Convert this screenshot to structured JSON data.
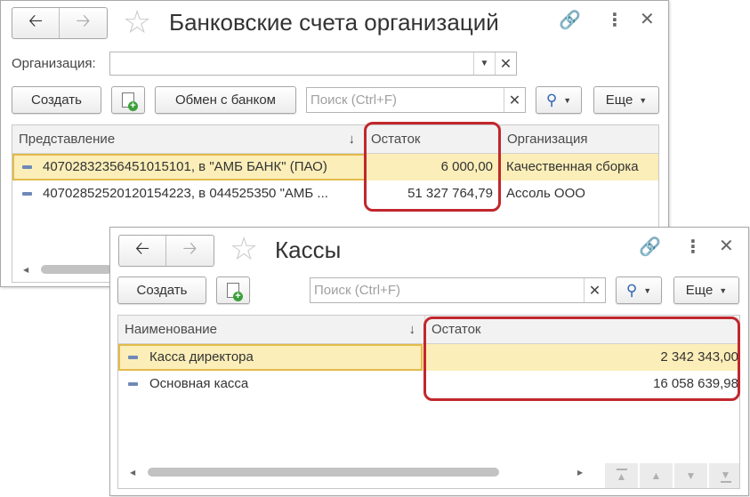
{
  "bank_window": {
    "title": "Банковские счета организаций",
    "org_label": "Организация:",
    "org_value": "",
    "buttons": {
      "create": "Создать",
      "exchange": "Обмен с банком",
      "more": "Еще"
    },
    "search_placeholder": "Поиск (Ctrl+F)",
    "columns": [
      "Представление",
      "Остаток",
      "Организация"
    ],
    "rows": [
      {
        "name": "40702832356451015101, в \"АМБ БАНК\" (ПАО)",
        "balance": "6 000,00",
        "org": "Качественная сборка",
        "selected": true
      },
      {
        "name": "40702852520120154223, в 044525350 \"АМБ ...",
        "balance": "51 327 764,79",
        "org": "Ассоль ООО",
        "selected": false
      }
    ]
  },
  "cash_window": {
    "title": "Кассы",
    "buttons": {
      "create": "Создать",
      "more": "Еще"
    },
    "search_placeholder": "Поиск (Ctrl+F)",
    "columns": [
      "Наименование",
      "Остаток"
    ],
    "rows": [
      {
        "name": "Касса директора",
        "balance": "2 342 343,00",
        "selected": true
      },
      {
        "name": "Основная касса",
        "balance": "16 058 639,98",
        "selected": false
      }
    ]
  },
  "icons": {
    "back": "arrow-left-icon",
    "forward": "arrow-right-icon",
    "favorite": "star-icon",
    "link": "link-icon",
    "menu": "more-vertical-icon",
    "close": "close-icon",
    "search": "magnifier-icon",
    "add_copy": "document-add-icon"
  },
  "colors": {
    "selection": "#fbeeb8",
    "highlight_frame": "#c1272d",
    "selected_row_border": "#e3bb4b"
  }
}
